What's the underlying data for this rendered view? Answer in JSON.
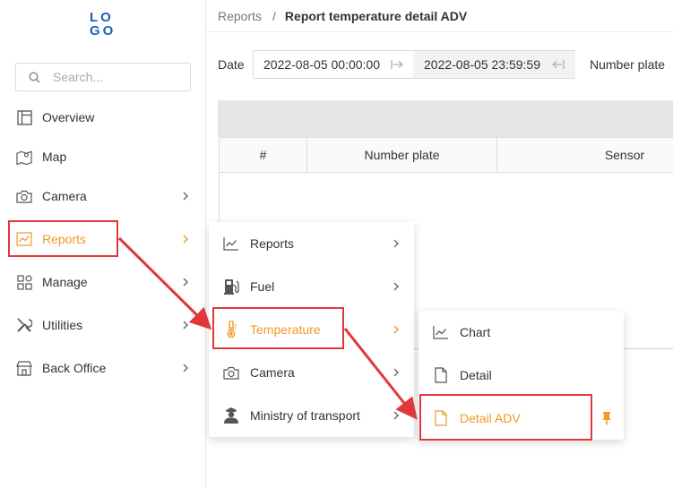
{
  "logo": {
    "line1": "LO",
    "line2": "GO"
  },
  "search": {
    "placeholder": "Search..."
  },
  "sidebar": {
    "items": [
      {
        "label": "Overview",
        "icon": "layout-icon"
      },
      {
        "label": "Map",
        "icon": "map-icon"
      },
      {
        "label": "Camera",
        "icon": "camera-icon"
      },
      {
        "label": "Reports",
        "icon": "line-chart-icon",
        "active": true
      },
      {
        "label": "Manage",
        "icon": "grid-icon"
      },
      {
        "label": "Utilities",
        "icon": "tools-icon"
      },
      {
        "label": "Back Office",
        "icon": "shop-icon"
      }
    ]
  },
  "breadcrumb": {
    "parent": "Reports",
    "separator": "/",
    "current": "Report temperature detail ADV"
  },
  "filters": {
    "date_label": "Date",
    "start": "2022-08-05 00:00:00",
    "end": "2022-08-05 23:59:59",
    "number_plate_label": "Number plate"
  },
  "table": {
    "columns": [
      "#",
      "Number plate",
      "Sensor"
    ]
  },
  "reports_menu": {
    "items": [
      {
        "label": "Reports",
        "icon": "line-chart-icon"
      },
      {
        "label": "Fuel",
        "icon": "fuel-pump-icon"
      },
      {
        "label": "Temperature",
        "icon": "thermometer-icon",
        "active": true
      },
      {
        "label": "Camera",
        "icon": "camera-icon"
      },
      {
        "label": "Ministry of transport",
        "icon": "officer-icon"
      }
    ]
  },
  "temperature_menu": {
    "items": [
      {
        "label": "Chart",
        "icon": "line-chart-icon"
      },
      {
        "label": "Detail",
        "icon": "file-icon"
      },
      {
        "label": "Detail ADV",
        "icon": "file-icon",
        "active": true,
        "pinned": true
      }
    ]
  },
  "colors": {
    "accent": "#f09a27",
    "highlight": "#e0383a",
    "logo": "#1e5fb4"
  }
}
